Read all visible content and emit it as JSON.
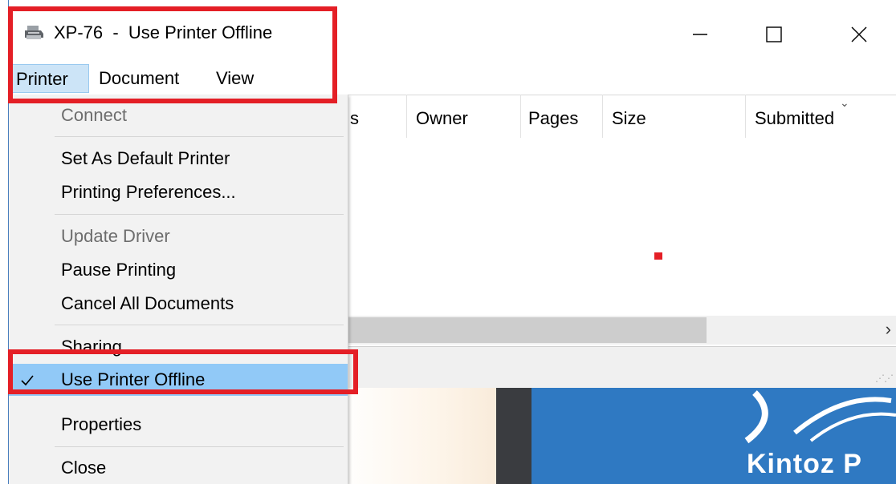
{
  "window": {
    "title": "XP-76  -  Use Printer Offline",
    "icon": "printer-icon",
    "controls": [
      "minimize-icon",
      "maximize-icon",
      "close-icon"
    ]
  },
  "menubar": {
    "items": [
      {
        "label": "Printer",
        "active": true
      },
      {
        "label": "Document",
        "active": false
      },
      {
        "label": "View",
        "active": false
      }
    ]
  },
  "printer_menu": {
    "connect": "Connect",
    "set_default": "Set As Default Printer",
    "preferences": "Printing Preferences...",
    "update_driver": "Update Driver",
    "pause": "Pause Printing",
    "cancel_all": "Cancel All Documents",
    "sharing": "Sharing",
    "use_offline": "Use Printer Offline",
    "properties": "Properties",
    "close": "Close"
  },
  "columns": {
    "status_fragment": "s",
    "owner": "Owner",
    "pages": "Pages",
    "size": "Size",
    "submitted": "Submitted"
  },
  "desktop": {
    "brand_text": "Kintoz P"
  },
  "colors": {
    "highlight": "#e41f26",
    "menu_selected": "#91c9f7",
    "menubar_active": "#cce4f7",
    "brand_blue": "#2f79c2"
  }
}
